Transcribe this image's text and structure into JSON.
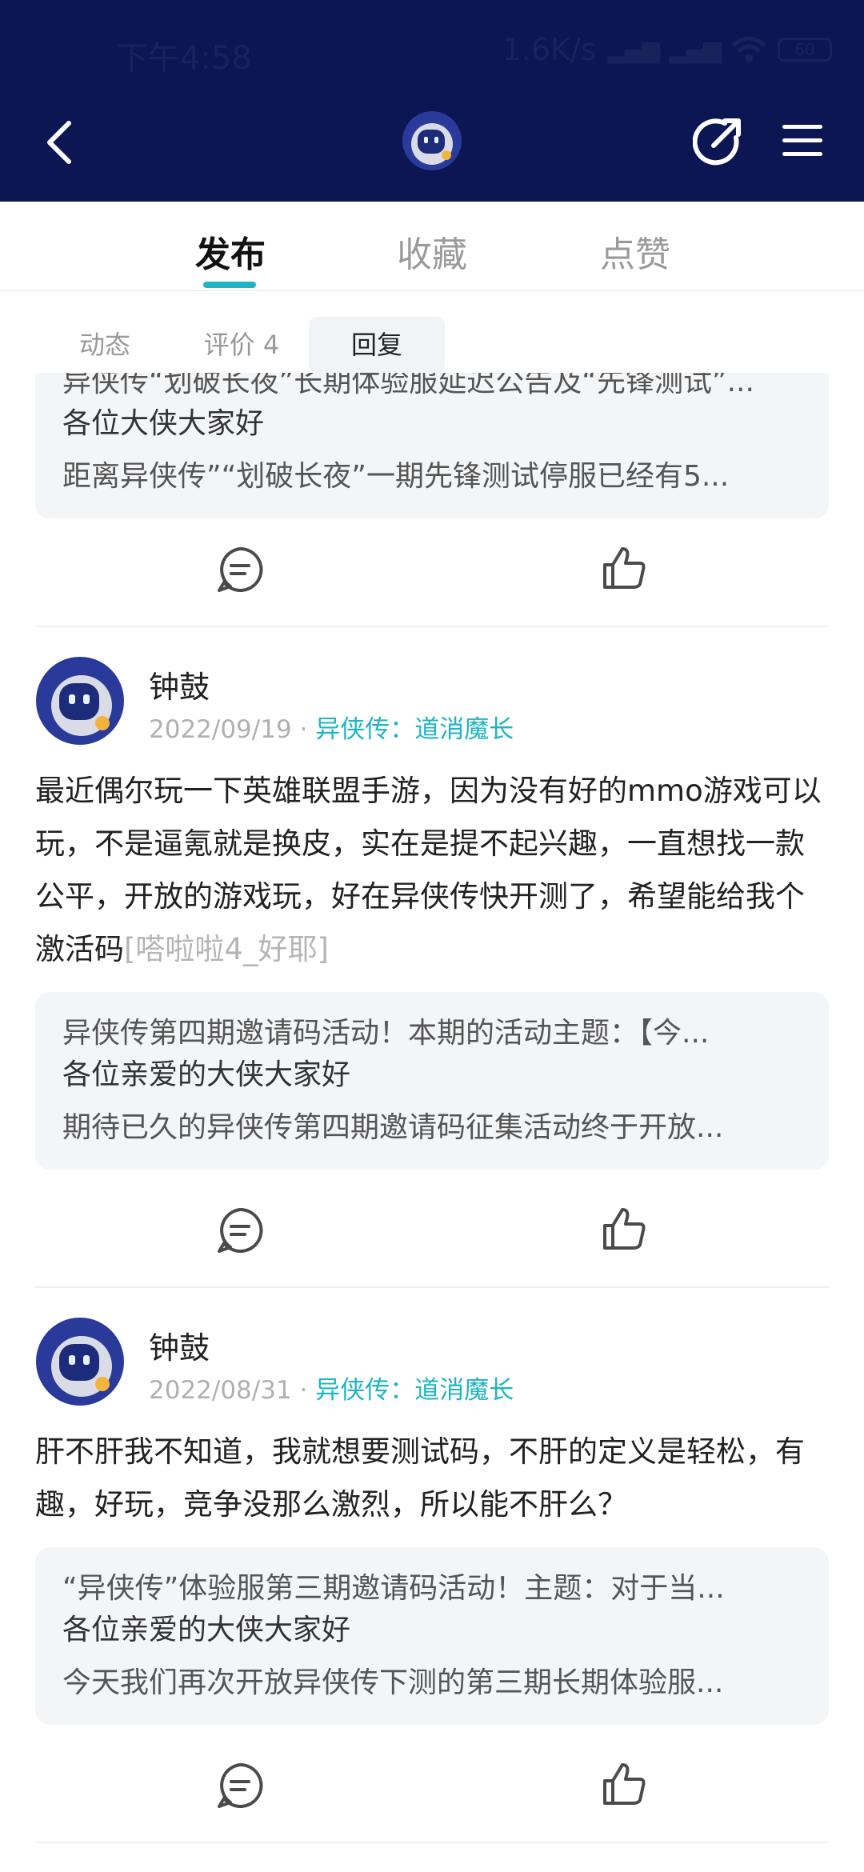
{
  "status_bar": {
    "time": "下午4:58",
    "speed": "1.6K/s",
    "battery": "60"
  },
  "header": {
    "icons": [
      "back-icon",
      "avatar",
      "share-icon",
      "menu-icon"
    ]
  },
  "tabs": [
    {
      "label": "发布",
      "active": true
    },
    {
      "label": "收藏",
      "active": false
    },
    {
      "label": "点赞",
      "active": false
    }
  ],
  "subtabs": [
    {
      "label": "动态",
      "active": false
    },
    {
      "label": "评价 4",
      "active": false
    },
    {
      "label": "回复",
      "active": true
    }
  ],
  "posts": [
    {
      "quote": {
        "title": "异侠传“划破长夜”长期体验服延迟公告及“先锋测试”...",
        "line2": "各位大侠大家好",
        "line3": "距离异侠传”“划破长夜”一期先锋测试停服已经有5..."
      }
    },
    {
      "user": "钟鼓",
      "date": "2022/09/19",
      "dot": "·",
      "game": "异侠传：道消魔长",
      "text": "最近偶尔玩一下英雄联盟手游，因为没有好的mmo游戏可以玩，不是逼氪就是换皮，实在是提不起兴趣，一直想找一款公平，开放的游戏玩，好在异侠传快开测了，希望能给我个激活码",
      "emoji": "[嗒啦啦4_好耶]",
      "quote": {
        "title": "异侠传第四期邀请码活动！本期的活动主题：【今...",
        "line2": "各位亲爱的大侠大家好",
        "line3": "期待已久的异侠传第四期邀请码征集活动终于开放..."
      }
    },
    {
      "user": "钟鼓",
      "date": "2022/08/31",
      "dot": "·",
      "game": "异侠传：道消魔长",
      "text": "肝不肝我不知道，我就想要测试码，不肝的定义是轻松，有趣，好玩，竞争没那么激烈，所以能不肝么？",
      "quote": {
        "title": "“异侠传”体验服第三期邀请码活动！主题：对于当...",
        "line2": "各位亲爱的大侠大家好",
        "line3": "今天我们再次开放异侠传下测的第三期长期体验服..."
      }
    }
  ],
  "colors": {
    "header_bg": "#0b1653",
    "accent": "#1fb6c4"
  }
}
